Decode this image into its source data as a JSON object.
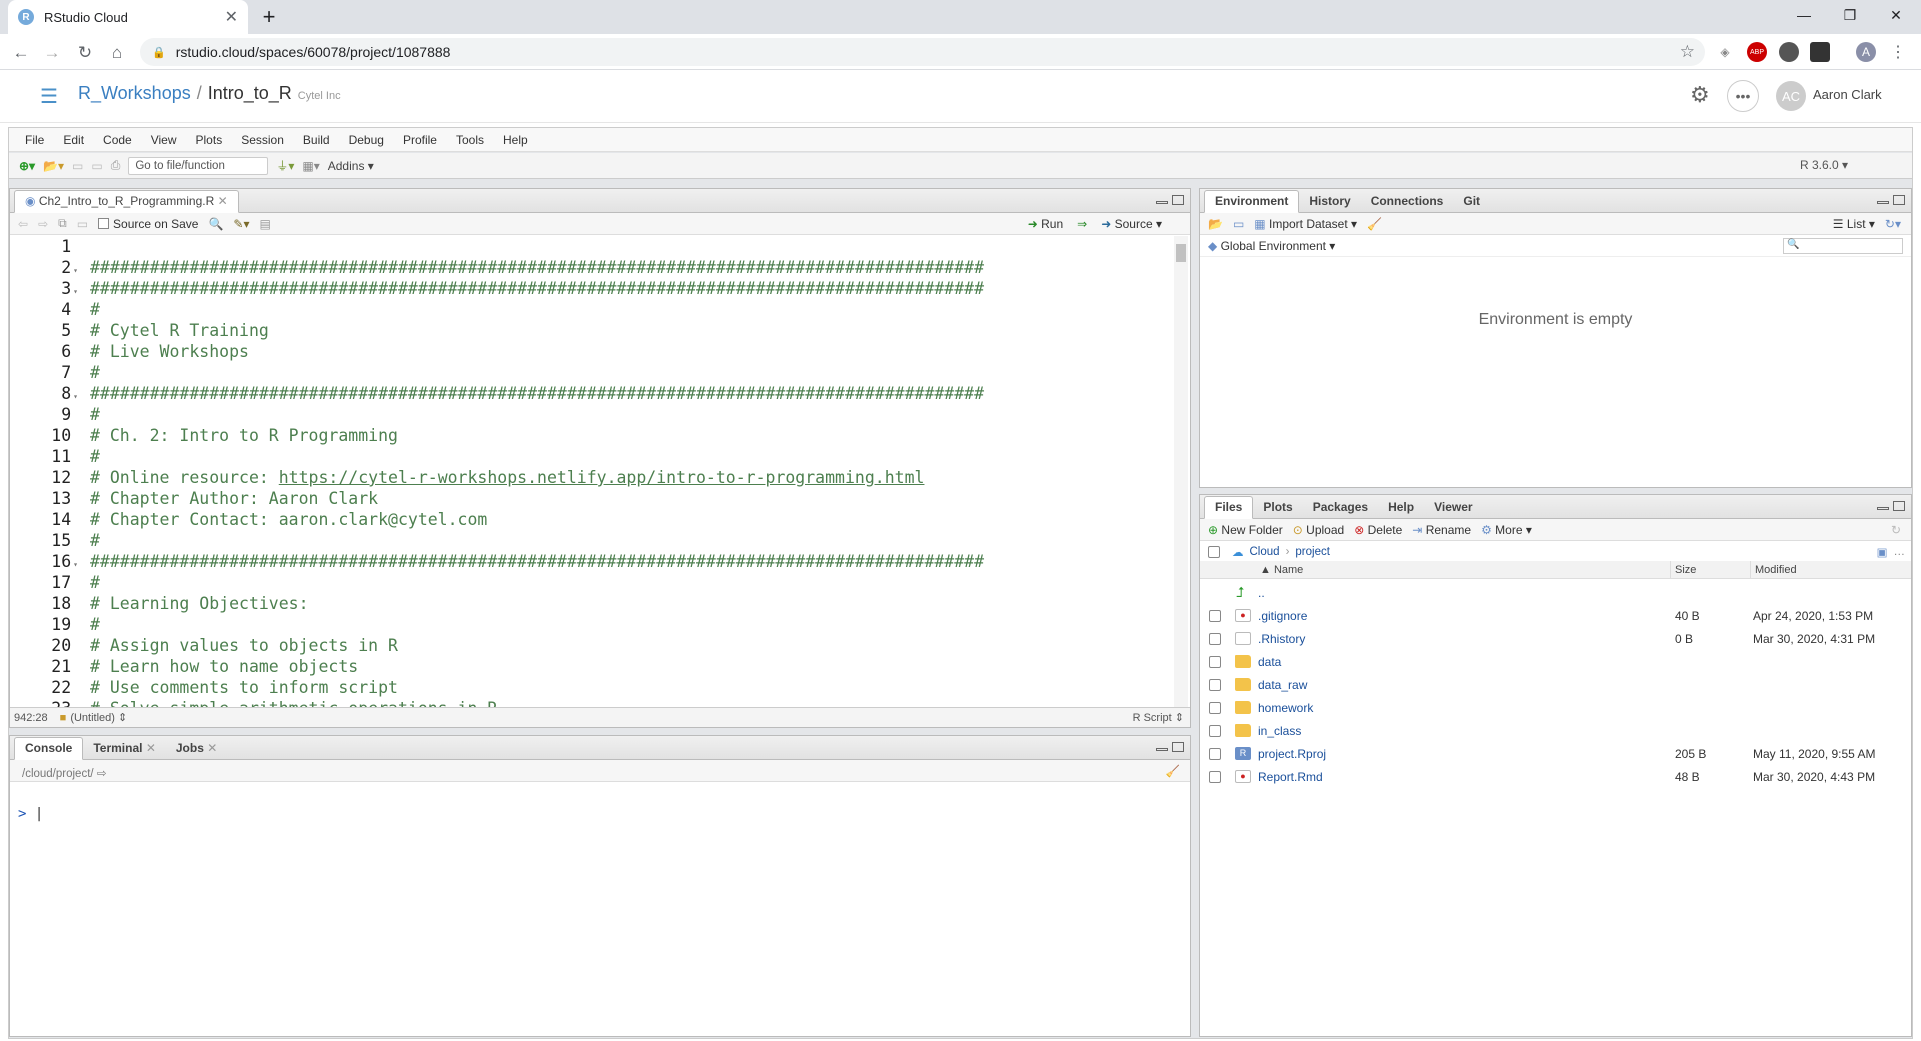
{
  "browser": {
    "tab_title": "RStudio Cloud",
    "favicon": "R",
    "url": "rstudio.cloud/spaces/60078/project/1087888",
    "profile_initial": "A"
  },
  "header": {
    "workspace": "R_Workshops",
    "separator": "/",
    "project": "Intro_to_R",
    "org": "Cytel Inc",
    "user_initials": "AC",
    "user_name": "Aaron Clark"
  },
  "menu": [
    "File",
    "Edit",
    "Code",
    "View",
    "Plots",
    "Session",
    "Build",
    "Debug",
    "Profile",
    "Tools",
    "Help"
  ],
  "toolbar": {
    "goto_placeholder": "Go to file/function",
    "addins": "Addins",
    "r_version": "R 3.6.0"
  },
  "editor": {
    "tab": "Ch2_Intro_to_R_Programming.R",
    "source_on_save": "Source on Save",
    "run": "Run",
    "source": "Source",
    "cursor_pos": "942:28",
    "scope": "(Untitled)",
    "filetype": "R Script",
    "lines": [
      "",
      "##########################################################################################",
      "##########################################################################################",
      "#",
      "# Cytel R Training",
      "# Live Workshops",
      "#",
      "##########################################################################################",
      "#",
      "# Ch. 2: Intro to R Programming",
      "#",
      "# Online resource: https://cytel-r-workshops.netlify.app/intro-to-r-programming.html",
      "# Chapter Author: Aaron Clark",
      "# Chapter Contact: aaron.clark@cytel.com",
      "#",
      "##########################################################################################",
      "#",
      "# Learning Objectives:",
      "#",
      "# Assign values to objects in R",
      "# Learn how to name objects",
      "# Use comments to inform script",
      "# Solve simple arithmetic operations in R"
    ]
  },
  "console": {
    "tabs": [
      "Console",
      "Terminal",
      "Jobs"
    ],
    "path": "/cloud/project/",
    "prompt": ">"
  },
  "env": {
    "tabs": [
      "Environment",
      "History",
      "Connections",
      "Git"
    ],
    "import": "Import Dataset",
    "list": "List",
    "global": "Global Environment",
    "empty": "Environment is empty"
  },
  "files": {
    "tabs": [
      "Files",
      "Plots",
      "Packages",
      "Help",
      "Viewer"
    ],
    "new_folder": "New Folder",
    "upload": "Upload",
    "delete": "Delete",
    "rename": "Rename",
    "more": "More",
    "crumb_cloud": "Cloud",
    "crumb_project": "project",
    "col_name": "Name",
    "col_size": "Size",
    "col_modified": "Modified",
    "up": "..",
    "rows": [
      {
        "name": ".gitignore",
        "size": "40 B",
        "modified": "Apr 24, 2020, 1:53 PM",
        "icon": "gitignore-icon"
      },
      {
        "name": ".Rhistory",
        "size": "0 B",
        "modified": "Mar 30, 2020, 4:31 PM",
        "icon": "text-file-icon"
      },
      {
        "name": "data",
        "size": "",
        "modified": "",
        "icon": "folder-icon"
      },
      {
        "name": "data_raw",
        "size": "",
        "modified": "",
        "icon": "folder-icon"
      },
      {
        "name": "homework",
        "size": "",
        "modified": "",
        "icon": "folder-icon"
      },
      {
        "name": "in_class",
        "size": "",
        "modified": "",
        "icon": "folder-icon"
      },
      {
        "name": "project.Rproj",
        "size": "205 B",
        "modified": "May 11, 2020, 9:55 AM",
        "icon": "rproj-icon"
      },
      {
        "name": "Report.Rmd",
        "size": "48 B",
        "modified": "Mar 30, 2020, 4:43 PM",
        "icon": "rmd-icon"
      }
    ]
  }
}
